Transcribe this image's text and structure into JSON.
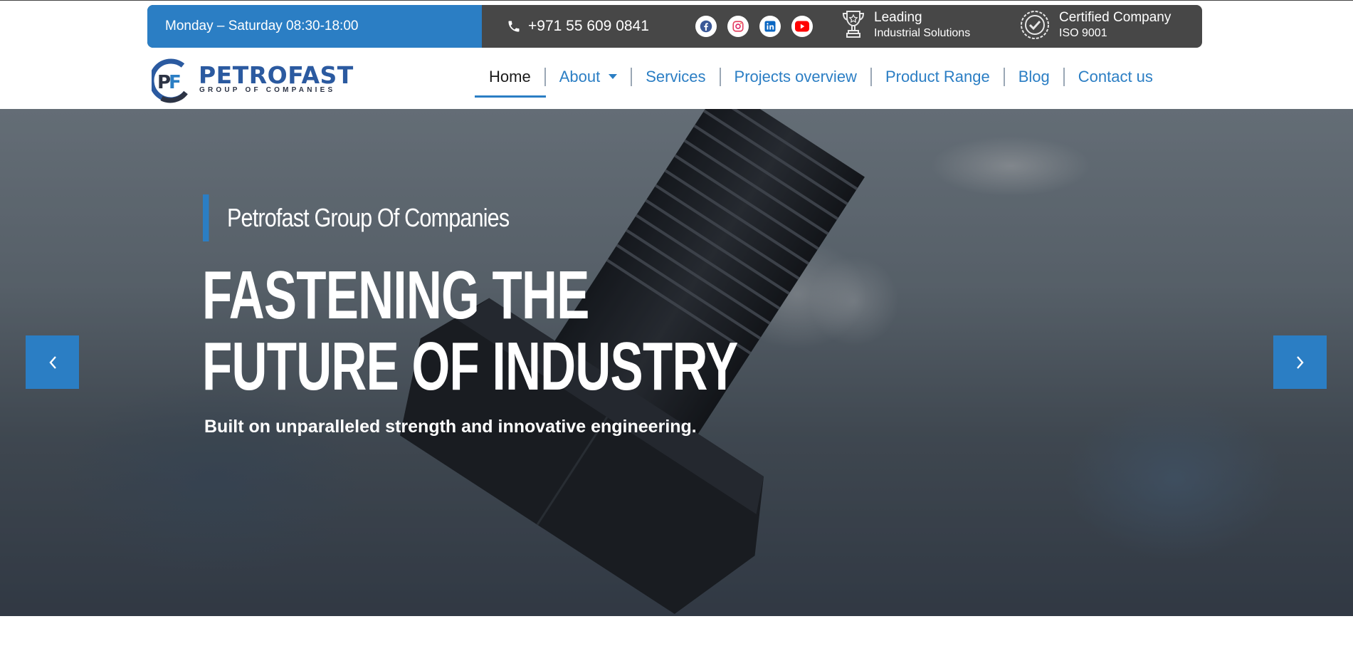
{
  "topbar": {
    "hours": "Monday – Saturday 08:30-18:00",
    "phone": "+971 55 609 0841",
    "socials": [
      "facebook-icon",
      "instagram-icon",
      "linkedin-icon",
      "youtube-icon"
    ],
    "badges": [
      {
        "icon": "trophy-icon",
        "title": "Leading",
        "subtitle": "Industrial Solutions"
      },
      {
        "icon": "certificate-icon",
        "title": "Certified Company",
        "subtitle": "ISO 9001"
      }
    ]
  },
  "logo": {
    "word": "PETROFAST",
    "sub": "GROUP OF COMPANIES"
  },
  "nav": {
    "items": [
      {
        "label": "Home",
        "active": true
      },
      {
        "label": "About"
      },
      {
        "label": "Services"
      },
      {
        "label": "Projects overview"
      },
      {
        "label": "Product Range"
      },
      {
        "label": "Blog"
      },
      {
        "label": "Contact us"
      }
    ]
  },
  "hero": {
    "eyebrow": "Petrofast Group Of Companies",
    "headline_line1": "FASTENING THE",
    "headline_line2": "FUTURE OF INDUSTRY",
    "tagline": "Built on unparalleled strength and innovative engineering."
  },
  "colors": {
    "accent": "#2b7ec4",
    "dark": "#474747"
  }
}
